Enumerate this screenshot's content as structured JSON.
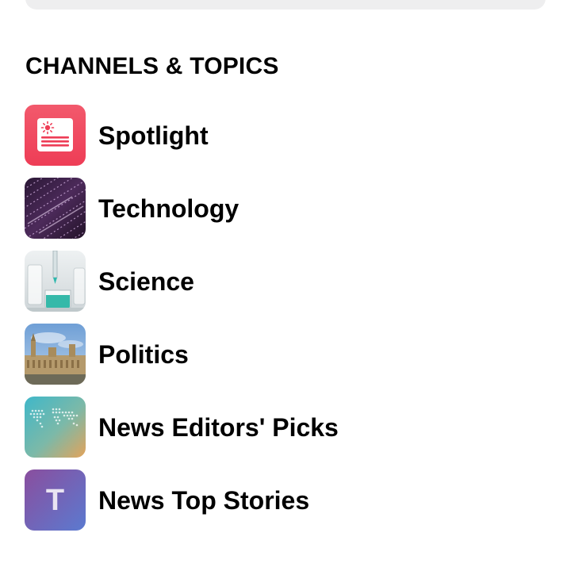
{
  "section": {
    "title": "CHANNELS & TOPICS"
  },
  "channels": [
    {
      "label": "Spotlight",
      "icon": "spotlight-icon"
    },
    {
      "label": "Technology",
      "icon": "technology-thumbnail"
    },
    {
      "label": "Science",
      "icon": "science-thumbnail"
    },
    {
      "label": "Politics",
      "icon": "politics-thumbnail"
    },
    {
      "label": "News Editors' Picks",
      "icon": "world-map-icon"
    },
    {
      "label": "News Top Stories",
      "icon": "top-stories-icon",
      "letter": "T"
    }
  ],
  "colors": {
    "spotlight": "#f0465e",
    "technology": "#3a1f45",
    "science": "#dfe4e6",
    "politics": "#8fb3dc",
    "editors_picks_start": "#3fb7c9",
    "editors_picks_end": "#e3a35a",
    "top_stories_start": "#8a4e9e",
    "top_stories_end": "#5b7ad0"
  }
}
